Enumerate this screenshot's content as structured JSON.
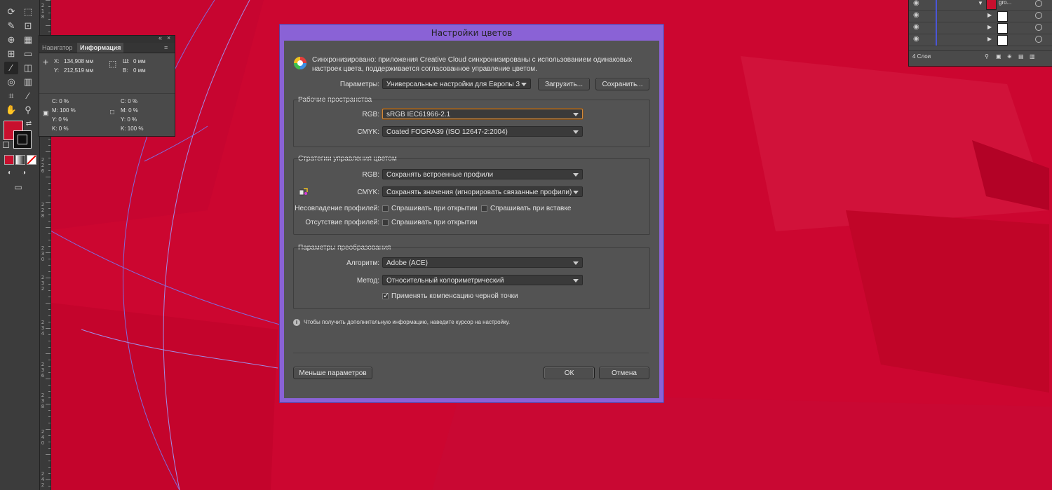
{
  "colors": {
    "canvas": "#cc0630",
    "dialog_bg": "#535353",
    "dialog_frame": "#8a62d6",
    "fill": "#c8102e",
    "guide": "#6e5ad8"
  },
  "ruler": {
    "labels": [
      "2\n1\n8",
      "2\n2\n6",
      "2\n2\n8",
      "2\n3\n0",
      "2\n3\n2",
      "2\n3\n4",
      "2\n3\n6",
      "2\n3\n8",
      "2\n4\n0",
      "2\n4\n2"
    ]
  },
  "toolbar": {
    "tools": [
      "lasso-icon",
      "transform-icon",
      "warp-icon",
      "shape-builder-icon",
      "perspective-icon",
      "mesh-icon",
      "gradient-icon",
      "eyedropper-icon",
      "blend-icon",
      "symbol-sprayer-icon",
      "graph-icon",
      "artboard-icon",
      "slice-icon",
      "hand-icon",
      "zoom-icon"
    ]
  },
  "info_panel": {
    "tabs": [
      "Навигатор",
      "Информация"
    ],
    "x_label": "X:",
    "x_value": "134,908 мм",
    "y_label": "Y:",
    "y_value": "212,519 мм",
    "w_label": "Ш:",
    "w_value": "0 мм",
    "h_label": "В:",
    "h_value": "0 мм",
    "left_cmyk": [
      "C: 0 %",
      "M: 100 %",
      "Y: 0 %",
      "K: 0 %"
    ],
    "right_cmyk": [
      "C: 0 %",
      "M: 0 %",
      "Y: 0 %",
      "K: 100 %"
    ]
  },
  "layers_panel": {
    "top_layer": "gro...",
    "footer": "4 Слои"
  },
  "dialog": {
    "title": "Настройки цветов",
    "sync_text_line1": "Синхронизировано: приложения Creative Cloud синхронизированы с использованием одинаковых",
    "sync_text_line2": "настроек цвета, поддерживается согласованное управление цветом.",
    "params_label": "Параметры:",
    "params_value": "Универсальные настройки для Европы 3",
    "load_button": "Загрузить...",
    "save_button": "Сохранить...",
    "workspaces": {
      "title": "Рабочие пространства",
      "rgb_label": "RGB:",
      "rgb_value": "sRGB IEC61966-2.1",
      "cmyk_label": "CMYK:",
      "cmyk_value": "Coated FOGRA39 (ISO 12647-2:2004)"
    },
    "policies": {
      "title": "Стратегии управления цветом",
      "rgb_label": "RGB:",
      "rgb_value": "Сохранять встроенные профили",
      "cmyk_label": "CMYK:",
      "cmyk_value": "Сохранять значения (игнорировать связанные профили)",
      "mismatch_label": "Несовпадение профилей:",
      "ask_open": "Спрашивать при открытии",
      "ask_paste": "Спрашивать при вставке",
      "missing_label": "Отсутствие профилей:",
      "ask_open_missing": "Спрашивать при открытии"
    },
    "conversion": {
      "title": "Параметры преобразования",
      "engine_label": "Алгоритм:",
      "engine_value": "Adobe (ACE)",
      "intent_label": "Метод:",
      "intent_value": "Относительный колориметрический",
      "bpc_label": "Применять компенсацию черной точки",
      "bpc_checked": true
    },
    "hint": "Чтобы получить дополнительную информацию, наведите курсор на настройку.",
    "fewer_options_button": "Меньше параметров",
    "ok_button": "ОК",
    "cancel_button": "Отмена"
  }
}
